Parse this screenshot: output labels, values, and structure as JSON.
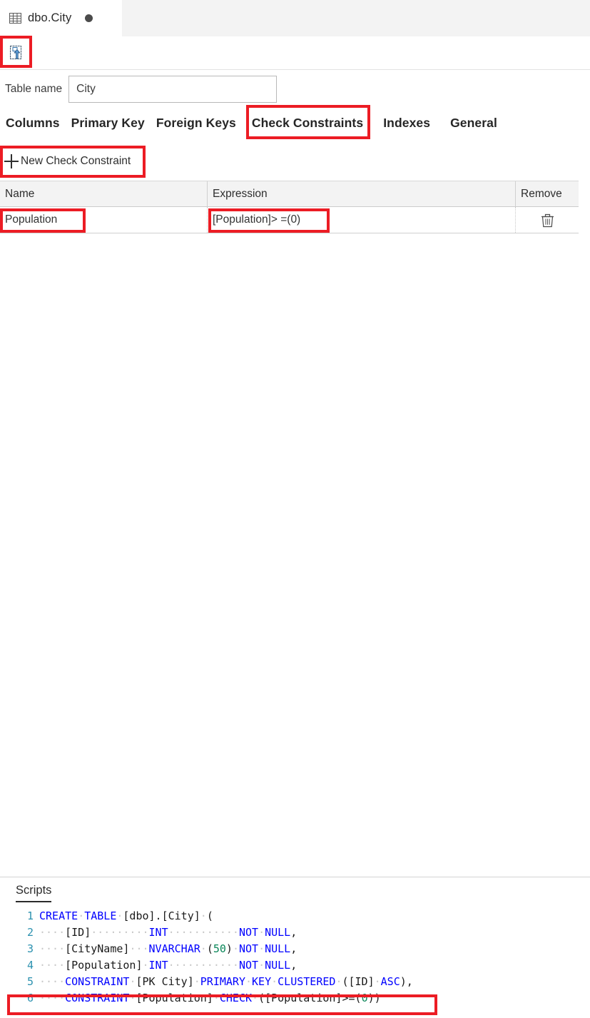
{
  "tab": {
    "title": "dbo.City",
    "icon": "table-grid-icon",
    "dirty_indicator": "unsaved-dot"
  },
  "toolbar": {
    "publish_label": "Publish",
    "publish_icon": "publish-update-icon"
  },
  "table_name": {
    "label": "Table name",
    "value": "City",
    "placeholder": ""
  },
  "designer_tabs": [
    {
      "label": "Columns",
      "selected": false
    },
    {
      "label": "Primary Key",
      "selected": false
    },
    {
      "label": "Foreign Keys",
      "selected": false
    },
    {
      "label": "Check Constraints",
      "selected": true
    },
    {
      "label": "Indexes",
      "selected": false
    },
    {
      "label": "General",
      "selected": false
    }
  ],
  "new_check": {
    "label": "New Check Constraint",
    "icon": "plus-icon"
  },
  "grid": {
    "columns": [
      "Name",
      "Expression",
      "Remove"
    ],
    "rows": [
      {
        "name": "Population",
        "expression": "[Population]> =(0)",
        "remove_icon": "trash-icon"
      }
    ]
  },
  "scripts": {
    "tab_label": "Scripts",
    "lines": [
      {
        "number": "1",
        "tokens": [
          {
            "t": "CREATE",
            "c": "kw"
          },
          {
            "t": "·",
            "c": "ws"
          },
          {
            "t": "TABLE",
            "c": "kw"
          },
          {
            "t": "·",
            "c": "ws"
          },
          {
            "t": "[dbo].[City]",
            "c": "br"
          },
          {
            "t": "·",
            "c": "ws"
          },
          {
            "t": "(",
            "c": "pl"
          }
        ]
      },
      {
        "number": "2",
        "tokens": [
          {
            "t": "····",
            "c": "ws"
          },
          {
            "t": "[ID]",
            "c": "br"
          },
          {
            "t": "·········",
            "c": "ws"
          },
          {
            "t": "INT",
            "c": "kw"
          },
          {
            "t": "···········",
            "c": "ws"
          },
          {
            "t": "NOT",
            "c": "kw"
          },
          {
            "t": "·",
            "c": "ws"
          },
          {
            "t": "NULL",
            "c": "kw"
          },
          {
            "t": ",",
            "c": "pl"
          }
        ]
      },
      {
        "number": "3",
        "tokens": [
          {
            "t": "····",
            "c": "ws"
          },
          {
            "t": "[CityName]",
            "c": "br"
          },
          {
            "t": "···",
            "c": "ws"
          },
          {
            "t": "NVARCHAR",
            "c": "kw"
          },
          {
            "t": "·",
            "c": "ws"
          },
          {
            "t": "(",
            "c": "pl"
          },
          {
            "t": "50",
            "c": "num"
          },
          {
            "t": ")",
            "c": "pl"
          },
          {
            "t": "·",
            "c": "ws"
          },
          {
            "t": "NOT",
            "c": "kw"
          },
          {
            "t": "·",
            "c": "ws"
          },
          {
            "t": "NULL",
            "c": "kw"
          },
          {
            "t": ",",
            "c": "pl"
          }
        ]
      },
      {
        "number": "4",
        "tokens": [
          {
            "t": "····",
            "c": "ws"
          },
          {
            "t": "[Population]",
            "c": "br"
          },
          {
            "t": "·",
            "c": "ws"
          },
          {
            "t": "INT",
            "c": "kw"
          },
          {
            "t": "···········",
            "c": "ws"
          },
          {
            "t": "NOT",
            "c": "kw"
          },
          {
            "t": "·",
            "c": "ws"
          },
          {
            "t": "NULL",
            "c": "kw"
          },
          {
            "t": ",",
            "c": "pl"
          }
        ]
      },
      {
        "number": "5",
        "tokens": [
          {
            "t": "····",
            "c": "ws"
          },
          {
            "t": "CONSTRAINT",
            "c": "kw"
          },
          {
            "t": "·",
            "c": "ws"
          },
          {
            "t": "[PK City]",
            "c": "br"
          },
          {
            "t": "·",
            "c": "ws"
          },
          {
            "t": "PRIMARY",
            "c": "kw"
          },
          {
            "t": "·",
            "c": "ws"
          },
          {
            "t": "KEY",
            "c": "kw"
          },
          {
            "t": "·",
            "c": "ws"
          },
          {
            "t": "CLUSTERED",
            "c": "kw"
          },
          {
            "t": "·",
            "c": "ws"
          },
          {
            "t": "(",
            "c": "pl"
          },
          {
            "t": "[ID]",
            "c": "br"
          },
          {
            "t": "·",
            "c": "ws"
          },
          {
            "t": "ASC",
            "c": "kw"
          },
          {
            "t": "),",
            "c": "pl"
          }
        ]
      },
      {
        "number": "6",
        "tokens": [
          {
            "t": "····",
            "c": "ws"
          },
          {
            "t": "CONSTRAINT",
            "c": "kw"
          },
          {
            "t": "·",
            "c": "ws"
          },
          {
            "t": "[Population]",
            "c": "br"
          },
          {
            "t": "·",
            "c": "ws"
          },
          {
            "t": "CHECK",
            "c": "kw"
          },
          {
            "t": "·",
            "c": "ws"
          },
          {
            "t": "([Population]>=(",
            "c": "pl"
          },
          {
            "t": "0",
            "c": "num"
          },
          {
            "t": "))",
            "c": "pl"
          }
        ]
      }
    ]
  },
  "colors": {
    "highlight": "#ec1c24",
    "keyword": "#0000ff",
    "number": "#098658",
    "line_number": "#2b91af",
    "tabbar_bg": "#f3f3f3",
    "grid_header_bg": "#f3f3f3"
  }
}
